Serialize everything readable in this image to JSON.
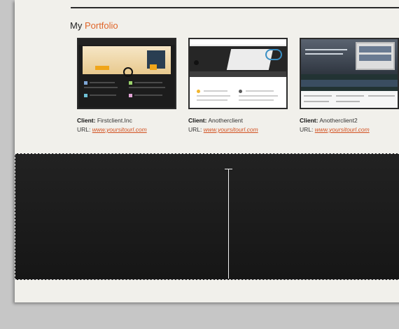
{
  "portfolio": {
    "title_prefix": "My",
    "title_accent": "Portfolio",
    "accent_color": "#e0662a",
    "items": [
      {
        "client_label": "Client:",
        "client_name": "Firstclient.Inc",
        "url_label": "URL:",
        "url": "www.yoursitourl.com",
        "thumbnail": "website-screenshot-1"
      },
      {
        "client_label": "Client:",
        "client_name": "Anotherclient",
        "url_label": "URL:",
        "url": "www.yoursitourl.com",
        "thumbnail": "website-screenshot-2"
      },
      {
        "client_label": "Client:",
        "client_name": "Anotherclient2",
        "url_label": "URL:",
        "url": "www.yoursitourl.com",
        "thumbnail": "website-screenshot-3"
      }
    ]
  },
  "selection_area": {
    "fill": "#1b1b1b",
    "border": "dashed",
    "cursor": "text-cursor-icon"
  }
}
